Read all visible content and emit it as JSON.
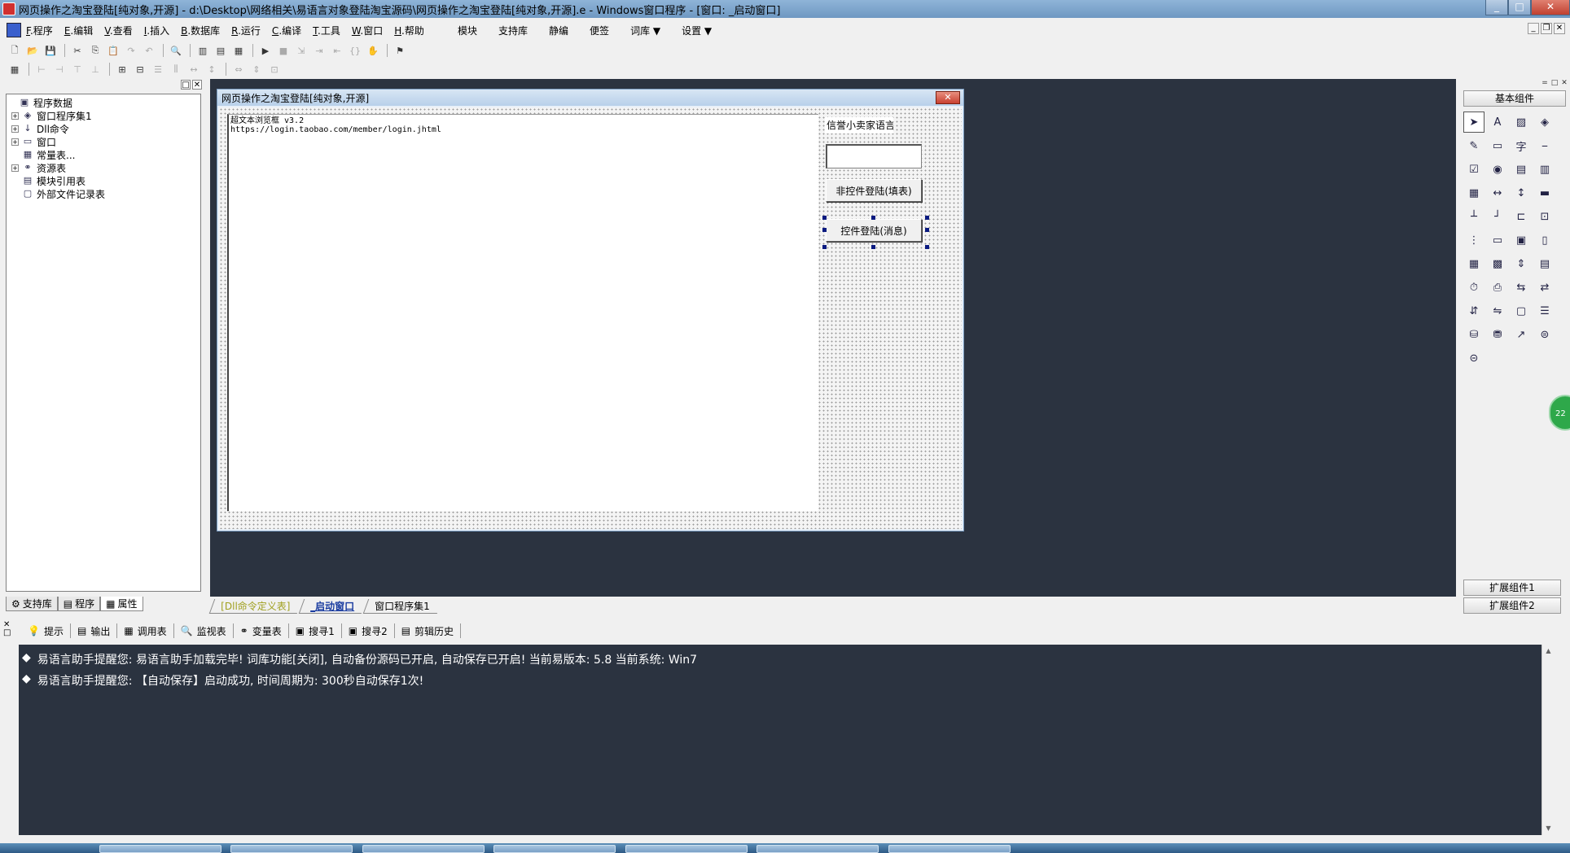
{
  "titlebar": {
    "title": "网页操作之淘宝登陆[纯对象,开源] - d:\\Desktop\\网络相关\\易语言对象登陆淘宝源码\\网页操作之淘宝登陆[纯对象,开源].e - Windows窗口程序 - [窗口: _启动窗口]",
    "min": "_",
    "max": "□",
    "close": "✕"
  },
  "menu": {
    "items": [
      {
        "key": "F",
        "label": ".程序"
      },
      {
        "key": "E",
        "label": ".编辑"
      },
      {
        "key": "V",
        "label": ".查看"
      },
      {
        "key": "I",
        "label": ".插入"
      },
      {
        "key": "B",
        "label": ".数据库"
      },
      {
        "key": "R",
        "label": ".运行"
      },
      {
        "key": "C",
        "label": ".编译"
      },
      {
        "key": "T",
        "label": ".工具"
      },
      {
        "key": "W",
        "label": ".窗口"
      },
      {
        "key": "H",
        "label": ".帮助"
      }
    ],
    "right_items": [
      "模块",
      "支持库",
      "静编",
      "便签",
      "词库 ▼",
      "设置 ▼"
    ]
  },
  "left_panel": {
    "tree": [
      {
        "label": "程序数据",
        "expander": "",
        "icon": "▣",
        "indent": 0
      },
      {
        "label": "窗口程序集1",
        "expander": "+",
        "icon": "◈",
        "indent": 1
      },
      {
        "label": "Dll命令",
        "expander": "+",
        "icon": "↓",
        "indent": 1
      },
      {
        "label": "窗口",
        "expander": "+",
        "icon": "▭",
        "indent": 1
      },
      {
        "label": "常量表...",
        "expander": "",
        "icon": "▦",
        "indent": 1
      },
      {
        "label": "资源表",
        "expander": "+",
        "icon": "⚭",
        "indent": 1
      },
      {
        "label": "模块引用表",
        "expander": "",
        "icon": "▤",
        "indent": 1
      },
      {
        "label": "外部文件记录表",
        "expander": "",
        "icon": "▢",
        "indent": 1
      }
    ],
    "tabs": [
      "支持库",
      "程序",
      "属性"
    ]
  },
  "designer": {
    "window_title": "网页操作之淘宝登陆[纯对象,开源]",
    "close": "✕",
    "browser_title": "超文本浏览框 v3.2",
    "browser_url": "https://login.taobao.com/member/login.jhtml",
    "label": "信誉小卖家语言",
    "input_value": "",
    "button1": "非控件登陆(填表)",
    "button2": "控件登陆(消息)"
  },
  "workarea_tabs": [
    "[Dll命令定义表]",
    "_启动窗口",
    "窗口程序集1"
  ],
  "toolbox": {
    "category": "基本组件",
    "bottom_categories": [
      "扩展组件1",
      "扩展组件2"
    ],
    "components": [
      "arrow-pointer",
      "label-A",
      "picture",
      "shape",
      "edit-pen",
      "frame",
      "text-char",
      "line",
      "checkbox",
      "radio",
      "listbox",
      "listview",
      "table",
      "scroll-h",
      "scroll-v",
      "progress",
      "ruler",
      "status",
      "slider",
      "tab",
      "grid",
      "button",
      "folder",
      "doc",
      "calendar",
      "image-list",
      "updown",
      "treeview",
      "clock",
      "printer",
      "network",
      "network2",
      "dde",
      "serial",
      "frame2",
      "toolbar",
      "db",
      "db2",
      "chart",
      "odbc",
      "odbc2"
    ],
    "bubble": "22"
  },
  "bottom": {
    "tabs": [
      "提示",
      "输出",
      "调用表",
      "监视表",
      "变量表",
      "搜寻1",
      "搜寻2",
      "剪辑历史"
    ],
    "output_lines": [
      "易语言助手提醒您:  易语言助手加载完毕! 词库功能[关闭], 自动备份源码已开启, 自动保存已开启! 当前易版本: 5.8  当前系统: Win7",
      "易语言助手提醒您: 【自动保存】启动成功, 时间周期为: 300秒自动保存1次!"
    ]
  }
}
